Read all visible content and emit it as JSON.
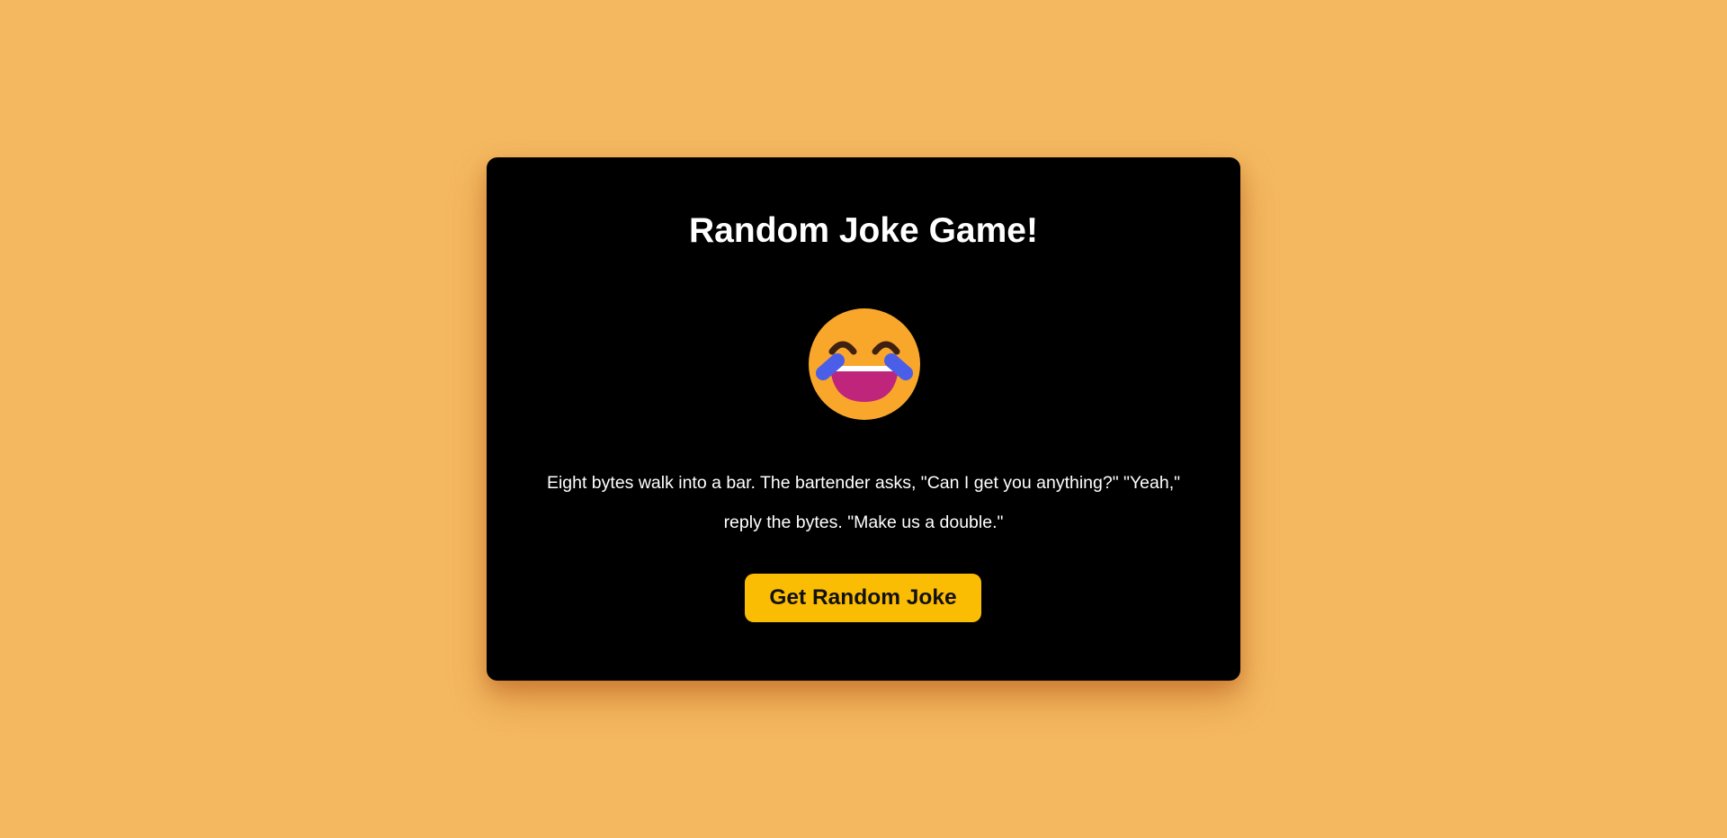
{
  "app": {
    "title": "Random Joke Game!"
  },
  "emoji": {
    "icon": "laughing-tears-icon"
  },
  "joke": {
    "text": "Eight bytes walk into a bar. The bartender asks, \"Can I get you anything?\" \"Yeah,\" reply the bytes. \"Make us a double.\""
  },
  "actions": {
    "get_joke_label": "Get Random Joke"
  },
  "colors": {
    "background": "#f4b960",
    "card": "#000000",
    "button": "#fbbc04",
    "text": "#ffffff"
  }
}
